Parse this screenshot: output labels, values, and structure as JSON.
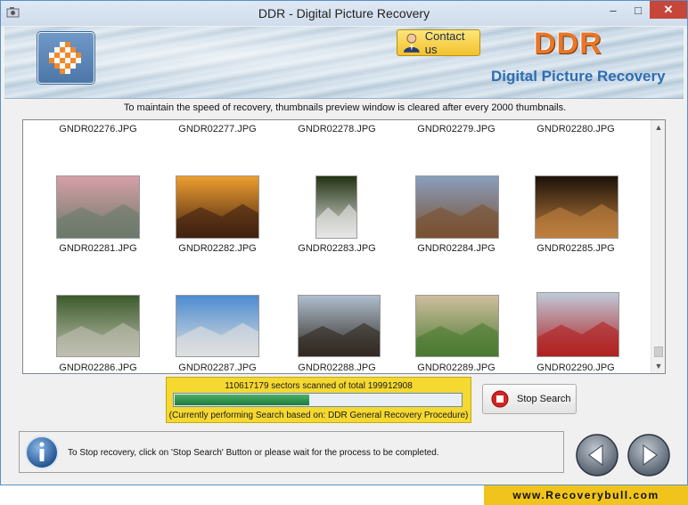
{
  "window": {
    "title": "DDR - Digital Picture Recovery",
    "minimize": "–",
    "maximize": "□",
    "close": "✕"
  },
  "header": {
    "contact_label": "Contact us",
    "brand": "DDR",
    "subtitle": "Digital Picture Recovery"
  },
  "notice": "To maintain the speed of recovery, thumbnails preview window is cleared after every 2000 thumbnails.",
  "thumbnails": {
    "rows": [
      {
        "files": [
          "GNDR02276.JPG",
          "GNDR02277.JPG",
          "GNDR02278.JPG",
          "GNDR02279.JPG",
          "GNDR02280.JPG"
        ]
      },
      {
        "files": [
          "GNDR02281.JPG",
          "GNDR02282.JPG",
          "GNDR02283.JPG",
          "GNDR02284.JPG",
          "GNDR02285.JPG"
        ]
      },
      {
        "files": [
          "GNDR02286.JPG",
          "GNDR02287.JPG",
          "GNDR02288.JPG",
          "GNDR02289.JPG",
          "GNDR02290.JPG"
        ]
      }
    ],
    "images": [
      {
        "name": "building-street-photo",
        "colors": [
          "#d8a0a8",
          "#6a7a6a"
        ]
      },
      {
        "name": "sunset-palm-photo",
        "colors": [
          "#f0a030",
          "#402010"
        ]
      },
      {
        "name": "person-white-coat-photo",
        "colors": [
          "#203010",
          "#e8e8e8"
        ]
      },
      {
        "name": "mountain-valley-photo",
        "colors": [
          "#8aa0c0",
          "#7a5030"
        ]
      },
      {
        "name": "night-restaurant-photo",
        "colors": [
          "#1a1008",
          "#c08040"
        ]
      },
      {
        "name": "garden-patio-photo",
        "colors": [
          "#3a5a2a",
          "#c0c0b0"
        ]
      },
      {
        "name": "modern-building-photo",
        "colors": [
          "#4a8ad0",
          "#e0e0e0"
        ]
      },
      {
        "name": "city-skyline-person-photo",
        "colors": [
          "#b0c0d0",
          "#302820"
        ]
      },
      {
        "name": "town-garden-photo",
        "colors": [
          "#d0c0a0",
          "#4a7a30"
        ]
      },
      {
        "name": "cable-car-photo",
        "colors": [
          "#c0ccdc",
          "#b02020"
        ]
      }
    ]
  },
  "progress": {
    "sectors_text": "110617179 sectors scanned of total 199912908",
    "fraction": 0.4714,
    "mode_text": "(Currently performing Search based on:  DDR General Recovery Procedure)"
  },
  "stop_label": "Stop Search",
  "status_text": "To Stop recovery, click on 'Stop Search' Button or please wait for the process to be completed.",
  "website": "www.Recoverybull.com",
  "colors": {
    "accent_blue": "#2d6db3",
    "brand_orange": "#e8762a",
    "progress_green": "#1f7a3c",
    "highlight_yellow": "#f5d830"
  }
}
